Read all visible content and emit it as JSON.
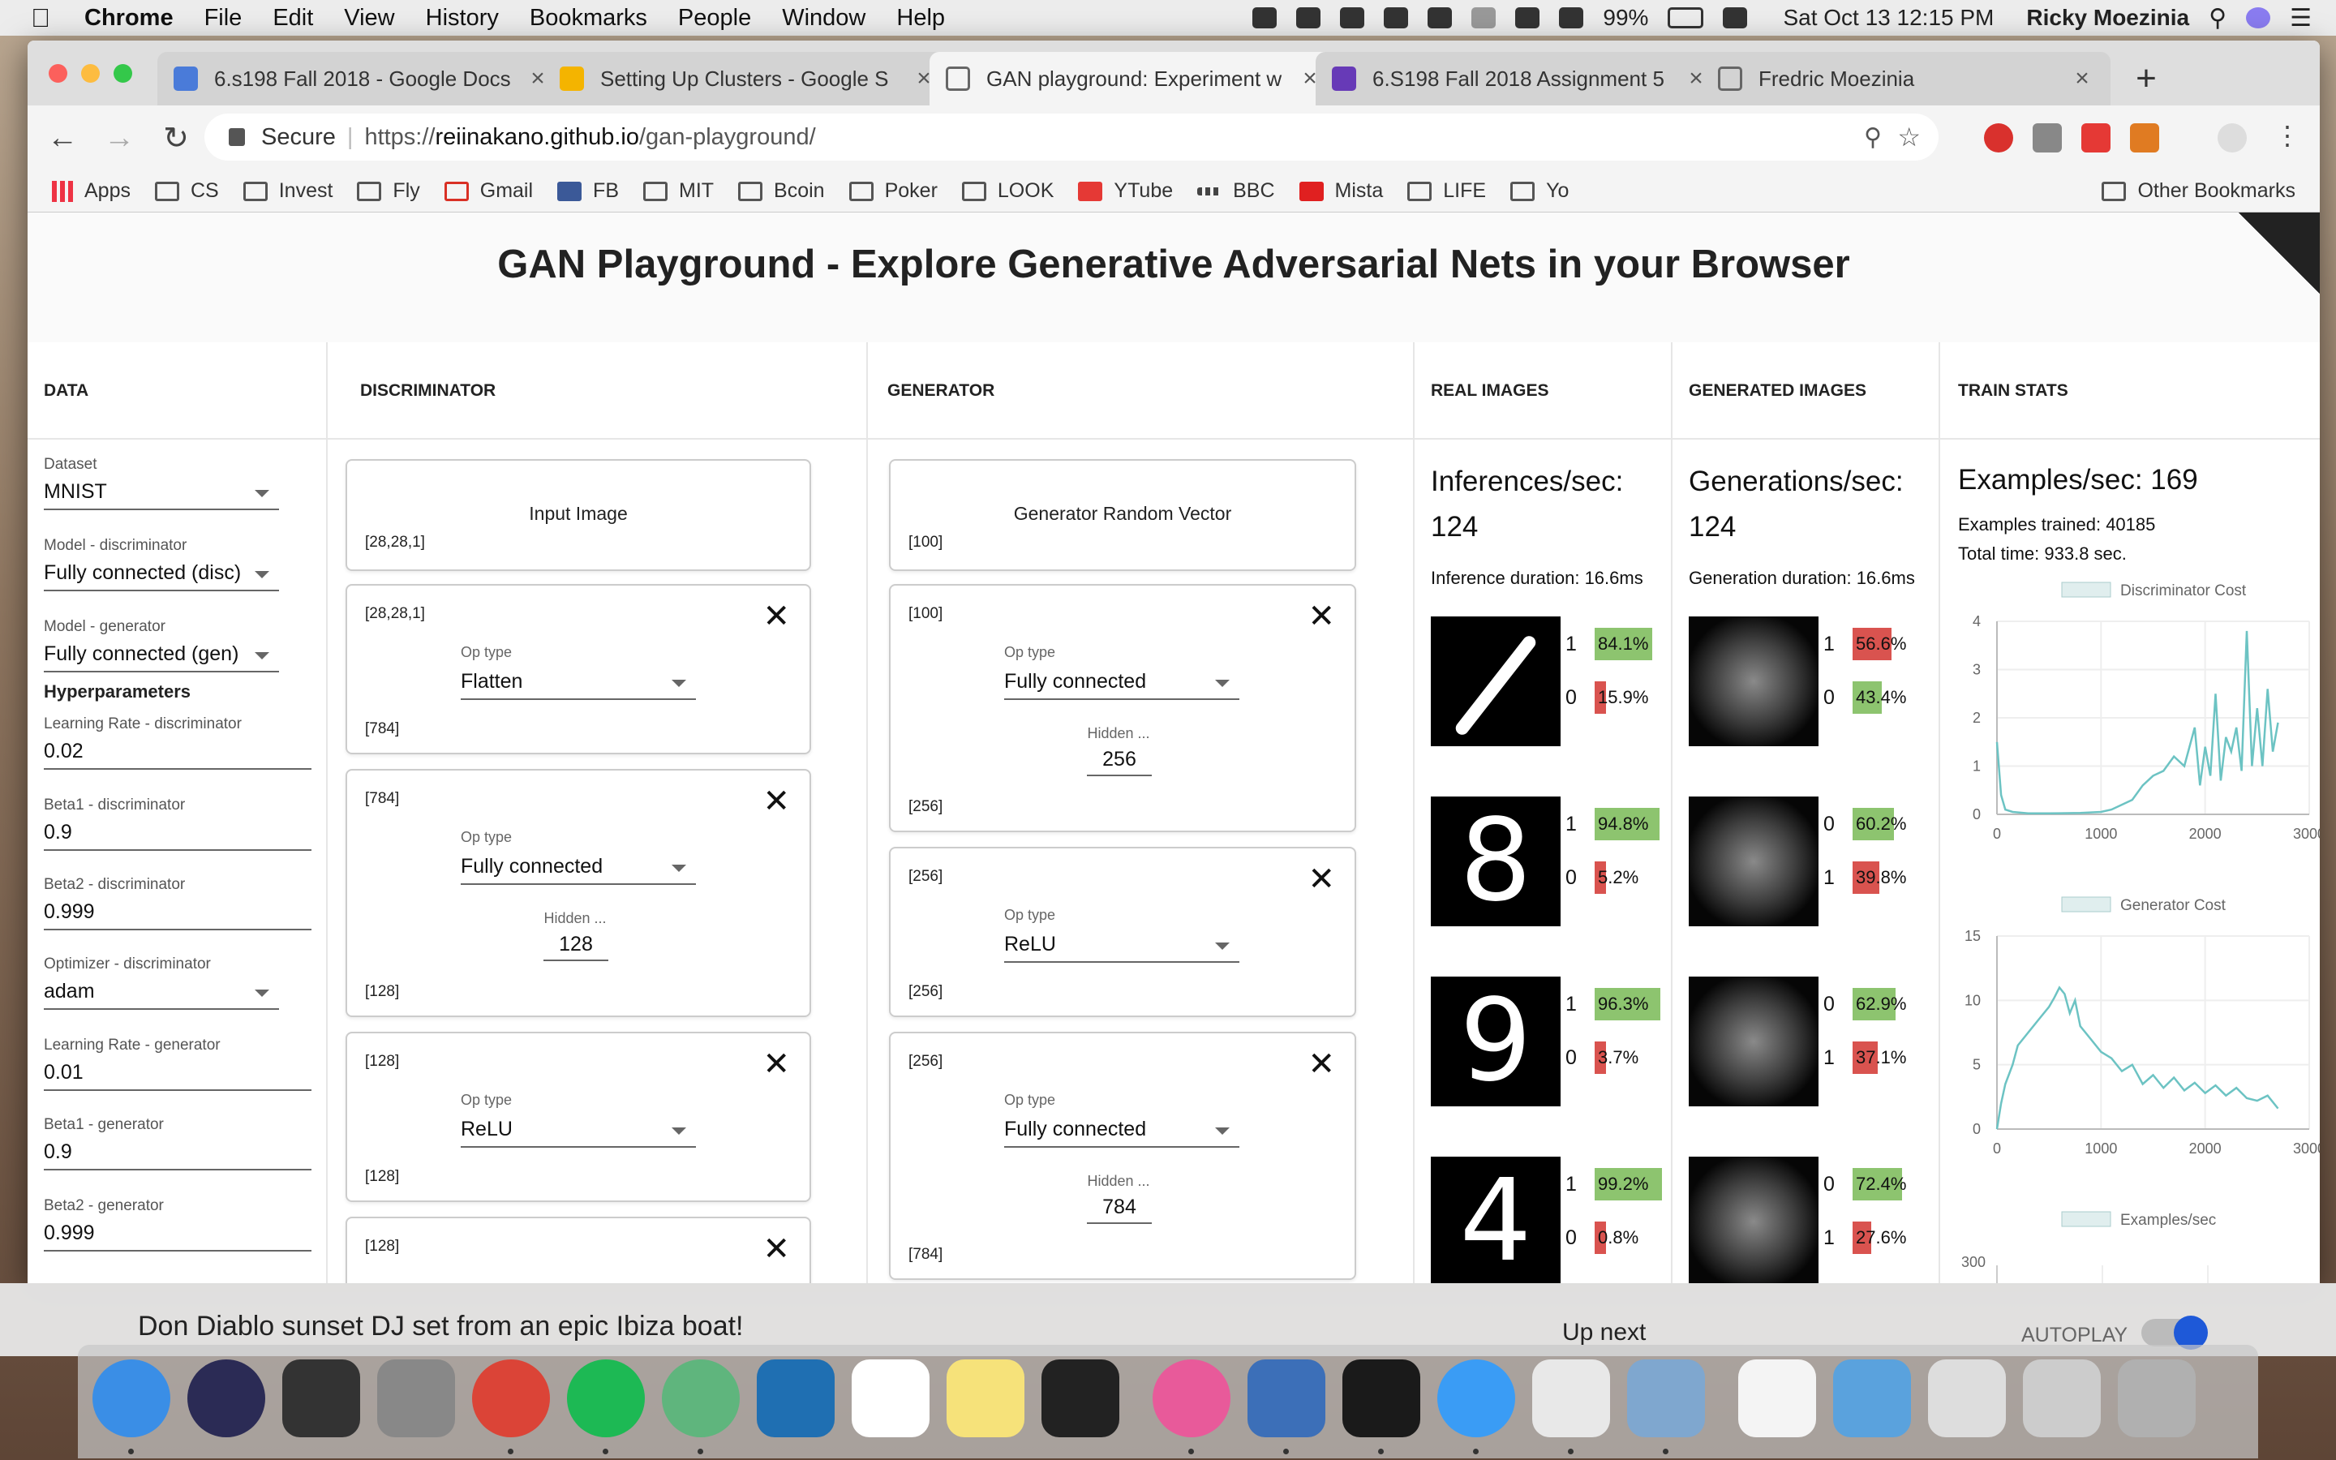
{
  "menubar": {
    "app": "Chrome",
    "menus": [
      "File",
      "Edit",
      "View",
      "History",
      "Bookmarks",
      "People",
      "Window",
      "Help"
    ],
    "battery": "99%",
    "datetime": "Sat Oct 13  12:15 PM",
    "user": "Ricky Moezinia"
  },
  "tabs": [
    {
      "title": "6.s198 Fall 2018 - Google Docs",
      "color": "#4a7bd9"
    },
    {
      "title": "Setting Up Clusters - Google S",
      "color": "#f4b400"
    },
    {
      "title": "GAN playground: Experiment w",
      "color": "#bbbbbb"
    },
    {
      "title": "6.S198 Fall 2018 Assignment 5",
      "color": "#673ab7"
    },
    {
      "title": "Fredric Moezinia",
      "color": "#bbbbbb"
    }
  ],
  "omnibox": {
    "secure": "Secure",
    "url_scheme": "https://",
    "url_host": "reiinakano.github.io",
    "url_path": "/gan-playground/"
  },
  "bookmarks": [
    "Apps",
    "CS",
    "Invest",
    "Fly",
    "Gmail",
    "FB",
    "MIT",
    "Bcoin",
    "Poker",
    "LOOK",
    "YTube",
    "BBC",
    "Mista",
    "LIFE",
    "Yo"
  ],
  "other_bookmarks": "Other Bookmarks",
  "page": {
    "title": "GAN Playground - Explore Generative Adversarial Nets in your Browser",
    "columns": {
      "data": "DATA",
      "discriminator": "DISCRIMINATOR",
      "generator": "GENERATOR",
      "real": "REAL IMAGES",
      "generated": "GENERATED IMAGES",
      "stats": "TRAIN STATS"
    },
    "data_fields": [
      {
        "label": "Dataset",
        "value": "MNIST"
      },
      {
        "label": "Model - discriminator",
        "value": "Fully connected (disc)"
      },
      {
        "label": "Model - generator",
        "value": "Fully connected (gen)"
      }
    ],
    "hyperparameters_heading": "Hyperparameters",
    "hyper_fields": [
      {
        "label": "Learning Rate - discriminator",
        "value": "0.02"
      },
      {
        "label": "Beta1 - discriminator",
        "value": "0.9"
      },
      {
        "label": "Beta2 - discriminator",
        "value": "0.999"
      },
      {
        "label": "Optimizer - discriminator",
        "value": "adam"
      },
      {
        "label": "Learning Rate - generator",
        "value": "0.01"
      },
      {
        "label": "Beta1 - generator",
        "value": "0.9"
      },
      {
        "label": "Beta2 - generator",
        "value": "0.999"
      }
    ],
    "discriminator": {
      "input": {
        "title": "Input Image",
        "shape": "[28,28,1]"
      },
      "layers": [
        {
          "in": "[28,28,1]",
          "op_label": "Op type",
          "op": "Flatten",
          "out": "[784]"
        },
        {
          "in": "[784]",
          "op_label": "Op type",
          "op": "Fully connected",
          "hidden_label": "Hidden ...",
          "hidden": "128",
          "out": "[128]"
        },
        {
          "in": "[128]",
          "op_label": "Op type",
          "op": "ReLU",
          "out": "[128]"
        },
        {
          "in": "[128]"
        }
      ]
    },
    "generator": {
      "input": {
        "title": "Generator Random Vector",
        "shape": "[100]"
      },
      "layers": [
        {
          "in": "[100]",
          "op_label": "Op type",
          "op": "Fully connected",
          "hidden_label": "Hidden ...",
          "hidden": "256",
          "out": "[256]"
        },
        {
          "in": "[256]",
          "op_label": "Op type",
          "op": "ReLU",
          "out": "[256]"
        },
        {
          "in": "[256]",
          "op_label": "Op type",
          "op": "Fully connected",
          "hidden_label": "Hidden ...",
          "hidden": "784",
          "out": "[784]"
        }
      ]
    },
    "real": {
      "rate_label": "Inferences/sec:",
      "rate": "124",
      "duration": "Inference duration: 16.6ms",
      "images": [
        {
          "digit": "/",
          "preds": [
            {
              "label": "1",
              "pct": "84.1%",
              "frac": 0.841,
              "color": "green"
            },
            {
              "label": "0",
              "pct": "15.9%",
              "frac": 0.159,
              "color": "red"
            }
          ]
        },
        {
          "digit": "8",
          "preds": [
            {
              "label": "1",
              "pct": "94.8%",
              "frac": 0.948,
              "color": "green"
            },
            {
              "label": "0",
              "pct": "5.2%",
              "frac": 0.052,
              "color": "red"
            }
          ]
        },
        {
          "digit": "9",
          "preds": [
            {
              "label": "1",
              "pct": "96.3%",
              "frac": 0.963,
              "color": "green"
            },
            {
              "label": "0",
              "pct": "3.7%",
              "frac": 0.037,
              "color": "red"
            }
          ]
        },
        {
          "digit": "4",
          "preds": [
            {
              "label": "1",
              "pct": "99.2%",
              "frac": 0.992,
              "color": "green"
            },
            {
              "label": "0",
              "pct": "0.8%",
              "frac": 0.008,
              "color": "red"
            }
          ]
        }
      ]
    },
    "generated": {
      "rate_label": "Generations/sec:",
      "rate": "124",
      "duration": "Generation duration: 16.6ms",
      "images": [
        {
          "preds": [
            {
              "label": "1",
              "pct": "56.6%",
              "frac": 0.566,
              "color": "red"
            },
            {
              "label": "0",
              "pct": "43.4%",
              "frac": 0.434,
              "color": "green"
            }
          ]
        },
        {
          "preds": [
            {
              "label": "0",
              "pct": "60.2%",
              "frac": 0.602,
              "color": "green"
            },
            {
              "label": "1",
              "pct": "39.8%",
              "frac": 0.398,
              "color": "red"
            }
          ]
        },
        {
          "preds": [
            {
              "label": "0",
              "pct": "62.9%",
              "frac": 0.629,
              "color": "green"
            },
            {
              "label": "1",
              "pct": "37.1%",
              "frac": 0.371,
              "color": "red"
            }
          ]
        },
        {
          "preds": [
            {
              "label": "0",
              "pct": "72.4%",
              "frac": 0.724,
              "color": "green"
            },
            {
              "label": "1",
              "pct": "27.6%",
              "frac": 0.276,
              "color": "red"
            }
          ]
        }
      ]
    },
    "stats": {
      "examples_per_sec": "Examples/sec: 169",
      "examples_trained": "Examples trained: 40185",
      "total_time": "Total time: 933.8 sec."
    }
  },
  "chart_data": [
    {
      "type": "line",
      "series": [
        {
          "name": "Discriminator Cost",
          "color": "#6cc3c3",
          "x": [
            0,
            40,
            80,
            150,
            300,
            500,
            800,
            1000,
            1100,
            1200,
            1300,
            1400,
            1500,
            1600,
            1700,
            1800,
            1900,
            1950,
            2000,
            2050,
            2100,
            2150,
            2200,
            2250,
            2300,
            2350,
            2400,
            2450,
            2500,
            2550,
            2600,
            2650,
            2700
          ],
          "y": [
            1.5,
            0.4,
            0.1,
            0.05,
            0.02,
            0.02,
            0.03,
            0.05,
            0.1,
            0.2,
            0.3,
            0.6,
            0.8,
            0.9,
            1.2,
            1.0,
            1.8,
            0.6,
            1.4,
            0.8,
            2.5,
            0.7,
            1.6,
            1.3,
            1.8,
            0.9,
            3.8,
            1.0,
            2.2,
            1.0,
            2.6,
            1.3,
            1.9
          ]
        }
      ],
      "xlim": [
        0,
        3000
      ],
      "ylim": [
        0,
        4
      ],
      "xticks": [
        0,
        1000,
        2000,
        3000
      ],
      "yticks": [
        0,
        1,
        2,
        3,
        4
      ],
      "legend": "top"
    },
    {
      "type": "line",
      "series": [
        {
          "name": "Generator Cost",
          "color": "#6cc3c3",
          "x": [
            0,
            40,
            80,
            150,
            200,
            300,
            400,
            500,
            550,
            600,
            650,
            700,
            750,
            800,
            900,
            1000,
            1100,
            1200,
            1300,
            1400,
            1500,
            1600,
            1700,
            1800,
            1900,
            2000,
            2100,
            2200,
            2300,
            2400,
            2500,
            2600,
            2700
          ],
          "y": [
            0,
            2,
            3.5,
            5,
            6.5,
            7.5,
            8.5,
            9.5,
            10.2,
            11,
            10.5,
            9,
            10,
            8,
            7,
            6,
            5.5,
            4.5,
            5,
            3.5,
            4.2,
            3.2,
            4,
            3,
            3.6,
            2.8,
            3.4,
            2.6,
            3.2,
            2.4,
            2.2,
            2.6,
            1.6
          ]
        }
      ],
      "xlim": [
        0,
        3000
      ],
      "ylim": [
        0,
        15
      ],
      "xticks": [
        0,
        1000,
        2000,
        3000
      ],
      "yticks": [
        0,
        5,
        10,
        15
      ],
      "legend": "top"
    },
    {
      "type": "line",
      "series": [
        {
          "name": "Examples/sec",
          "color": "#6cc3c3",
          "x": [],
          "y": []
        }
      ],
      "yticks": [
        300
      ],
      "legend": "top"
    }
  ],
  "video": {
    "title": "Don Diablo sunset DJ set from an epic Ibiza boat!",
    "up_next": "Up next",
    "autoplay": "AUTOPLAY"
  },
  "dock_icons": [
    {
      "name": "finder-icon",
      "color": "#3a8ee6"
    },
    {
      "name": "siri-icon",
      "color": "#2b2b55"
    },
    {
      "name": "photo-booth-icon",
      "color": "#333333"
    },
    {
      "name": "launchpad-icon",
      "color": "#888888"
    },
    {
      "name": "chrome-icon",
      "color": "#db4437"
    },
    {
      "name": "spotify-icon",
      "color": "#1db954"
    },
    {
      "name": "atom-icon",
      "color": "#5fb57d"
    },
    {
      "name": "vscode-icon",
      "color": "#1f6fb2"
    },
    {
      "name": "calendar-icon",
      "color": "#ffffff"
    },
    {
      "name": "notes-icon",
      "color": "#f6e27a"
    },
    {
      "name": "terminal-icon",
      "color": "#222222"
    },
    {
      "name": "itunes-icon",
      "color": "#e85a9a"
    },
    {
      "name": "virtualbox-icon",
      "color": "#3c6fb8"
    },
    {
      "name": "activity-monitor-icon",
      "color": "#1a1a1a"
    },
    {
      "name": "messages-icon",
      "color": "#3a9cf5"
    },
    {
      "name": "slack-icon",
      "color": "#e8e8e8"
    },
    {
      "name": "preview-icon",
      "color": "#7fa7cf"
    },
    {
      "name": "documents-icon",
      "color": "#f4f4f4"
    },
    {
      "name": "folder-icon",
      "color": "#5aa2dd"
    },
    {
      "name": "chrome-window-icon",
      "color": "#dddddd"
    },
    {
      "name": "chrome-window-2-icon",
      "color": "#cccccc"
    },
    {
      "name": "trash-icon",
      "color": "#b0b0b0"
    }
  ]
}
